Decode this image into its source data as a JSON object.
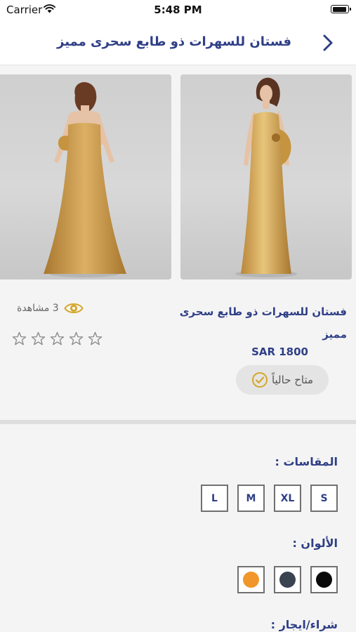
{
  "status_bar": {
    "carrier": "Carrier",
    "time": "5:48 PM"
  },
  "header": {
    "title": "فستان للسهرات ذو طابع سحرى مميز"
  },
  "product": {
    "name": "فستان للسهرات ذو طابع سحرى مميز",
    "price": "SAR 1800",
    "availability": "متاح حالياً",
    "views": "3 مشاهدة",
    "rating": 0,
    "rating_max": 5
  },
  "options": {
    "sizes_heading": "المقاسات :",
    "sizes": [
      "S",
      "XL",
      "M",
      "L"
    ],
    "colors_heading": "الألوان :",
    "colors": [
      "#0a0a0a",
      "#3a4350",
      "#f0962a"
    ],
    "buy_heading": "شراء/ايجار :"
  },
  "theme": {
    "accent": "#2f3f86",
    "check_gold": "#d4a62a",
    "dress_gold": "#d7a752"
  }
}
